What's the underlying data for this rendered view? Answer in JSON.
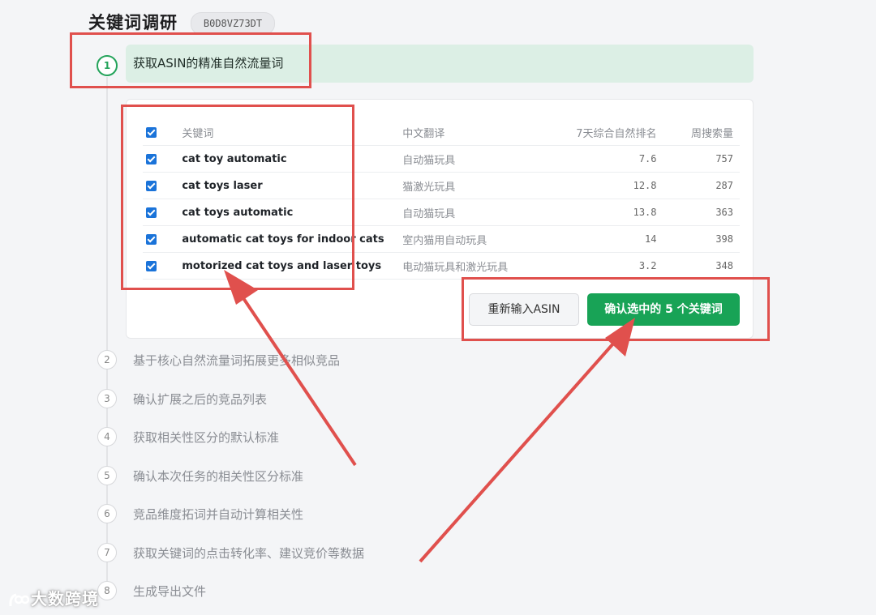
{
  "header": {
    "title": "关键词调研",
    "asin": "B0D8VZ73DT"
  },
  "steps": [
    {
      "number": "1",
      "label": "获取ASIN的精准自然流量词",
      "active": true
    },
    {
      "number": "2",
      "label": "基于核心自然流量词拓展更多相似竞品"
    },
    {
      "number": "3",
      "label": "确认扩展之后的竞品列表"
    },
    {
      "number": "4",
      "label": "获取相关性区分的默认标准"
    },
    {
      "number": "5",
      "label": "确认本次任务的相关性区分标准"
    },
    {
      "number": "6",
      "label": "竞品维度拓词并自动计算相关性"
    },
    {
      "number": "7",
      "label": "获取关键词的点击转化率、建议竞价等数据"
    },
    {
      "number": "8",
      "label": "生成导出文件"
    }
  ],
  "table": {
    "headers": {
      "keyword": "关键词",
      "translation": "中文翻译",
      "rank": "7天综合自然排名",
      "volume": "周搜索量"
    },
    "rows": [
      {
        "keyword": "cat toy automatic",
        "translation": "自动猫玩具",
        "rank": "7.6",
        "volume": "757",
        "checked": true
      },
      {
        "keyword": "cat toys laser",
        "translation": "猫激光玩具",
        "rank": "12.8",
        "volume": "287",
        "checked": true
      },
      {
        "keyword": "cat toys automatic",
        "translation": "自动猫玩具",
        "rank": "13.8",
        "volume": "363",
        "checked": true
      },
      {
        "keyword": "automatic cat toys for indoor cats",
        "translation": "室内猫用自动玩具",
        "rank": "14",
        "volume": "398",
        "checked": true
      },
      {
        "keyword": "motorized cat toys and laser toys",
        "translation": "电动猫玩具和激光玩具",
        "rank": "3.2",
        "volume": "348",
        "checked": true
      }
    ]
  },
  "buttons": {
    "reset": "重新输入ASIN",
    "confirm": "确认选中的 5 个关键词"
  },
  "watermark": "大数跨境",
  "colors": {
    "accent_green": "#18a356",
    "annotation_red": "#e0504d",
    "checkbox_blue": "#1a73d9"
  }
}
